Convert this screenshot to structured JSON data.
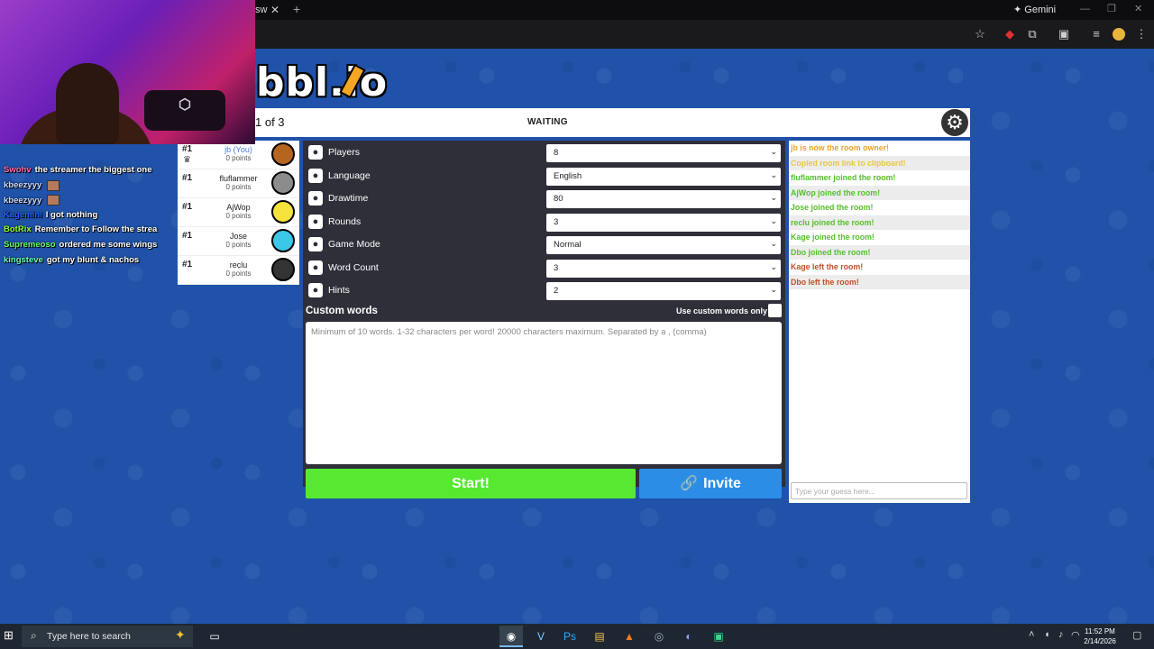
{
  "browser": {
    "tab_label": "sw",
    "tab_close": "✕",
    "new_tab": "+",
    "gemini_label": "Gemini",
    "window_controls": [
      "—",
      "❐",
      "✕"
    ]
  },
  "game": {
    "logo_text": "bbl.io",
    "round_text": "1 of 3",
    "status": "WAITING"
  },
  "players": [
    {
      "rank": "#1",
      "name": "jb (You)",
      "points": "0 points",
      "you": true,
      "face_color": "#b5651d"
    },
    {
      "rank": "#1",
      "name": "fluflammer",
      "points": "0 points",
      "you": false,
      "face_color": "#8c8c8c"
    },
    {
      "rank": "#1",
      "name": "AjWop",
      "points": "0 points",
      "you": false,
      "face_color": "#f5e23a"
    },
    {
      "rank": "#1",
      "name": "Jose",
      "points": "0 points",
      "you": false,
      "face_color": "#3bc7e8"
    },
    {
      "rank": "#1",
      "name": "reclu",
      "points": "0 points",
      "you": false,
      "face_color": "#333333"
    }
  ],
  "twitch_chat": [
    {
      "user": "Swohv",
      "color": "#ff6fa8",
      "text": "the streamer the biggest one"
    },
    {
      "user": "kbeezyyy",
      "color": "#c9dcff",
      "text": ""
    },
    {
      "user": "kbeezyyy",
      "color": "#c9dcff",
      "text": ""
    },
    {
      "user": "Kagemini",
      "color": "#1e64ff",
      "text": "I got nothing"
    },
    {
      "user": "BotRix",
      "color": "#8bff3d",
      "text": "Remember to Follow the strea"
    },
    {
      "user": "Supremeoso",
      "color": "#6cff6c",
      "text": "ordered me some wings"
    },
    {
      "user": "kingsteve",
      "color": "#6cffb0",
      "text": "got my blunt & nachos"
    }
  ],
  "settings": [
    {
      "label": "Players",
      "value": "8",
      "icon": "person-icon"
    },
    {
      "label": "Language",
      "value": "English",
      "icon": "language-icon"
    },
    {
      "label": "Drawtime",
      "value": "80",
      "icon": "clock-icon"
    },
    {
      "label": "Rounds",
      "value": "3",
      "icon": "rounds-icon"
    },
    {
      "label": "Game Mode",
      "value": "Normal",
      "icon": "gamemode-icon"
    },
    {
      "label": "Word Count",
      "value": "3",
      "icon": "wordcount-icon"
    },
    {
      "label": "Hints",
      "value": "2",
      "icon": "hint-icon"
    }
  ],
  "custom_words": {
    "title": "Custom words",
    "only_label": "Use custom words only",
    "placeholder": "Minimum of 10 words. 1-32 characters per word! 20000 characters maximum. Separated by a , (comma)"
  },
  "buttons": {
    "start": "Start!",
    "invite": "Invite"
  },
  "chat": {
    "messages": [
      {
        "text": "jb is now the room owner!",
        "color": "#f0a030"
      },
      {
        "text": "Copied room link to clipboard!",
        "color": "#e8c840"
      },
      {
        "text": "fluflammer joined the room!",
        "color": "#56c02b"
      },
      {
        "text": "AjWop joined the room!",
        "color": "#56c02b"
      },
      {
        "text": "Jose joined the room!",
        "color": "#56c02b"
      },
      {
        "text": "reclu joined the room!",
        "color": "#56c02b"
      },
      {
        "text": "Kage joined the room!",
        "color": "#56c02b"
      },
      {
        "text": "Dbo joined the room!",
        "color": "#56c02b"
      },
      {
        "text": "Kage left the room!",
        "color": "#c0502b"
      },
      {
        "text": "Dbo left the room!",
        "color": "#c0502b"
      }
    ],
    "input_placeholder": "Type your guess here..."
  },
  "taskbar": {
    "search_placeholder": "Type here to search",
    "time": "11:52 PM",
    "date": "2/14/2026"
  },
  "colors": {
    "background": "#1f52a8",
    "panel": "#2f2f3a",
    "start": "#56e92f",
    "invite": "#2c8de7"
  }
}
